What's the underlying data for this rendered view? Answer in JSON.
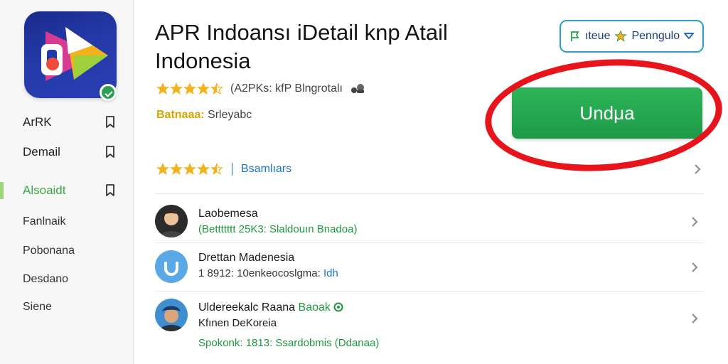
{
  "sidebar": {
    "items": [
      {
        "label": "ArRK"
      },
      {
        "label": "Demail"
      },
      {
        "label": "Alsoaidt"
      },
      {
        "label": "Fanlnaik"
      },
      {
        "label": "Pobonana"
      },
      {
        "label": "Desdano"
      },
      {
        "label": "Siene"
      }
    ],
    "active_index": 2
  },
  "app": {
    "title_line1": "APR Indoansı iDetail knp Atail",
    "title_line2": "Indonesia",
    "rating_stars": 4.5,
    "rating_text": "(A2PKs: kfP Blngrotalı",
    "meta_key": "Batnaaa:",
    "meta_value": "Srleyabc"
  },
  "language_button": {
    "label": "ıteue",
    "label2": "Penngulo"
  },
  "download_button": {
    "label": "Undμa"
  },
  "review_summary": {
    "rating_stars": 4.5,
    "link": "Bsamlıars"
  },
  "list": [
    {
      "title": "Laobemesa",
      "sub_green": "(Bettttttt 25K3: Slaldouın Bnadoa)"
    },
    {
      "title": "Drettan Madenesia",
      "sub_plain": "1 8912: 10enkeocoslgma:",
      "sub_blue": "Idh"
    },
    {
      "title": "Uldereekalc Raana",
      "title_tag": "Baoak",
      "title2": "Kfınen DeKoreia",
      "sub_green": "Spokonk: 1813: Ssardobmis (Ddanaa)"
    }
  ],
  "colors": {
    "accent_green": "#1f9a48",
    "highlight_red": "#e8141c",
    "link_blue": "#1a73c8",
    "star": "#f2b21b"
  }
}
